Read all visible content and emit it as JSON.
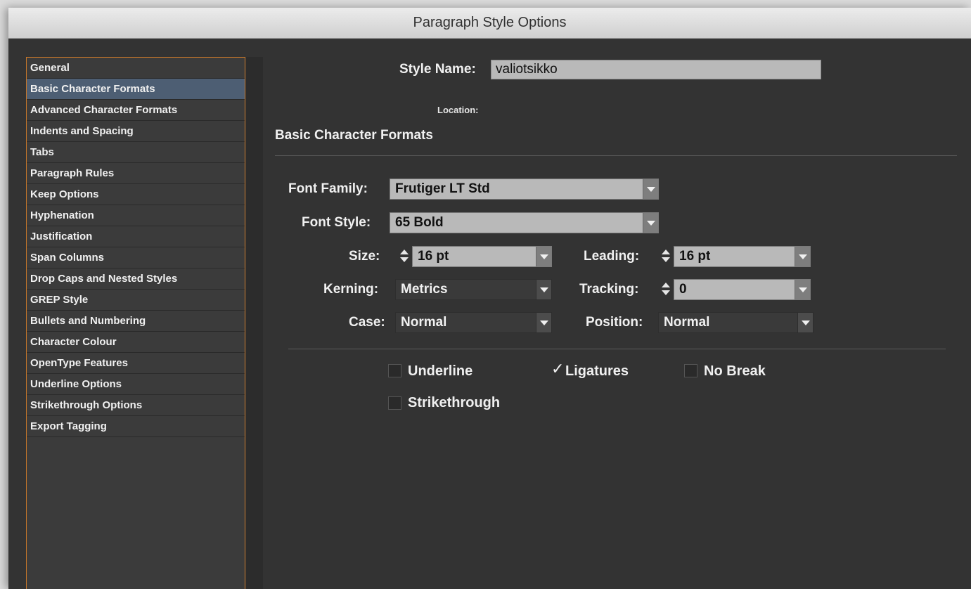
{
  "window": {
    "title": "Paragraph Style Options"
  },
  "sidebar": {
    "items": [
      {
        "label": "General"
      },
      {
        "label": "Basic Character Formats",
        "selected": true
      },
      {
        "label": "Advanced Character Formats"
      },
      {
        "label": "Indents and Spacing"
      },
      {
        "label": "Tabs"
      },
      {
        "label": "Paragraph Rules"
      },
      {
        "label": "Keep Options"
      },
      {
        "label": "Hyphenation"
      },
      {
        "label": "Justification"
      },
      {
        "label": "Span Columns"
      },
      {
        "label": "Drop Caps and Nested Styles"
      },
      {
        "label": "GREP Style"
      },
      {
        "label": "Bullets and Numbering"
      },
      {
        "label": "Character Colour"
      },
      {
        "label": "OpenType Features"
      },
      {
        "label": "Underline Options"
      },
      {
        "label": "Strikethrough Options"
      },
      {
        "label": "Export Tagging"
      }
    ]
  },
  "header": {
    "style_name_label": "Style Name:",
    "style_name_value": "valiotsikko",
    "location_label": "Location:"
  },
  "section": {
    "title": "Basic Character Formats"
  },
  "fields": {
    "font_family": {
      "label": "Font Family:",
      "value": "Frutiger LT Std"
    },
    "font_style": {
      "label": "Font Style:",
      "value": "65 Bold"
    },
    "size": {
      "label": "Size:",
      "value": "16 pt"
    },
    "leading": {
      "label": "Leading:",
      "value": "16 pt"
    },
    "kerning": {
      "label": "Kerning:",
      "value": "Metrics"
    },
    "tracking": {
      "label": "Tracking:",
      "value": "0"
    },
    "case": {
      "label": "Case:",
      "value": "Normal"
    },
    "position": {
      "label": "Position:",
      "value": "Normal"
    }
  },
  "checkboxes": {
    "underline": {
      "label": "Underline",
      "checked": false
    },
    "ligatures": {
      "label": "Ligatures",
      "checked": true
    },
    "no_break": {
      "label": "No Break",
      "checked": false
    },
    "strikethrough": {
      "label": "Strikethrough",
      "checked": false
    }
  },
  "icons": {
    "checkmark": "✓"
  }
}
